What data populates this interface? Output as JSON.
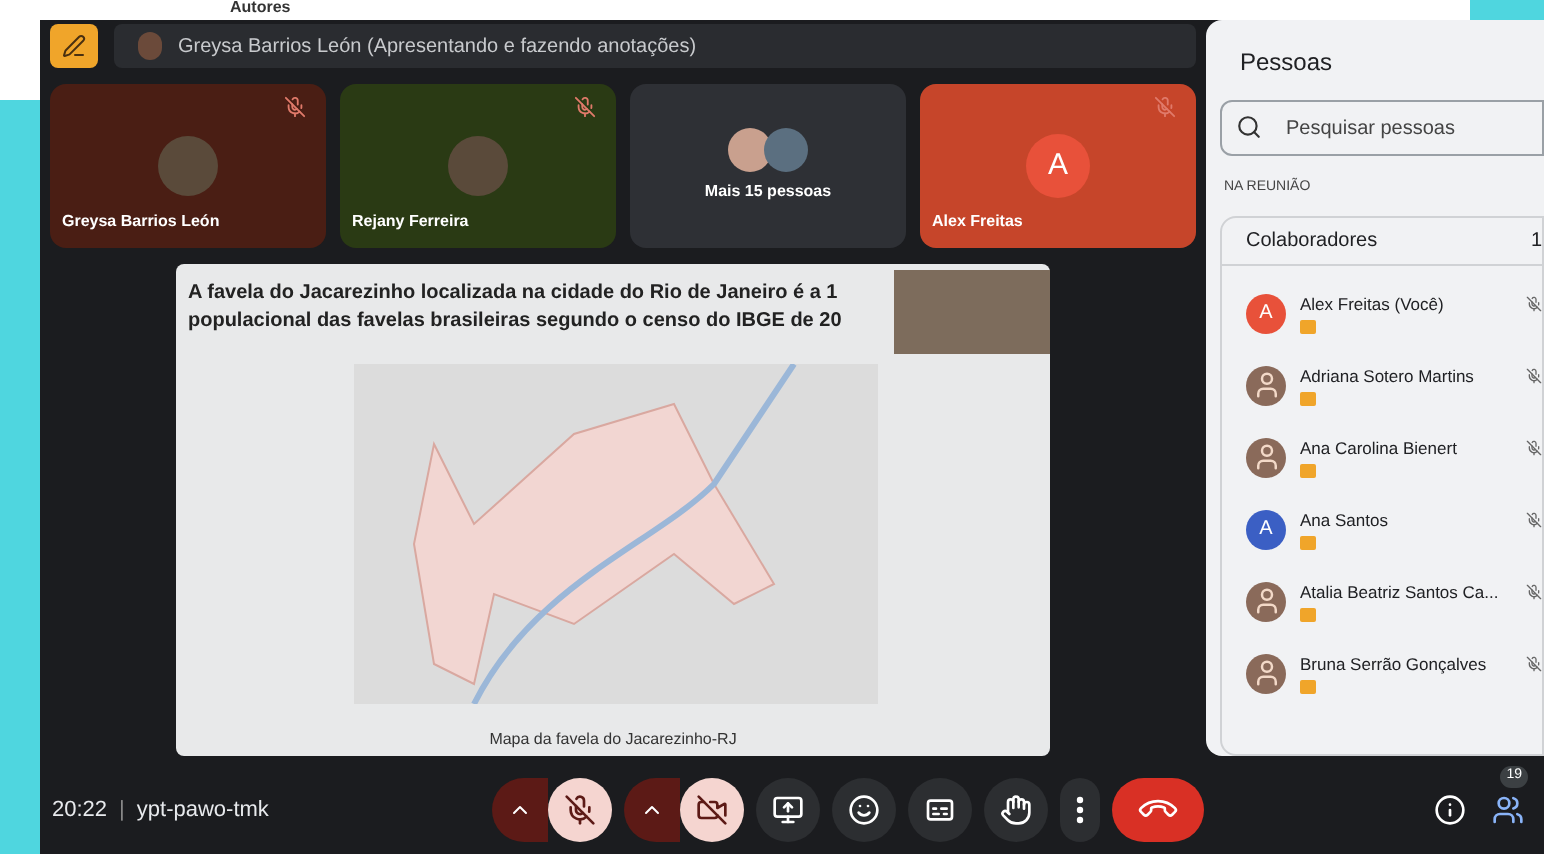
{
  "header": {
    "label": "Autores"
  },
  "presenter_banner": {
    "text": "Greysa Barrios León (Apresentando e fazendo anotações)"
  },
  "tiles": [
    {
      "name": "Greysa Barrios León",
      "kind": "photo",
      "muted": true,
      "color": "#4a1e14"
    },
    {
      "name": "Rejany Ferreira",
      "kind": "photo",
      "muted": true,
      "color": "#2a3a14"
    },
    {
      "name": "Mais 15 pessoas",
      "kind": "group",
      "muted": false,
      "color": "#2e3035"
    },
    {
      "name": "Alex Freitas",
      "kind": "letter",
      "initial": "A",
      "muted": true,
      "color": "#c6452a"
    }
  ],
  "slide": {
    "title": "A favela do Jacarezinho localizada na cidade do Rio de Janeiro é a 1\npopulacional das favelas brasileiras segundo o censo do IBGE de 20",
    "caption": "Mapa da favela do Jacarezinho-RJ"
  },
  "people_panel": {
    "title": "Pessoas",
    "search": {
      "placeholder": "Pesquisar pessoas"
    },
    "section": "NA REUNIÃO",
    "group": {
      "label": "Colaboradores",
      "count": "1"
    },
    "people": [
      {
        "name": "Alex Freitas (Você)",
        "kind": "letter",
        "initial": "A",
        "color": "#e8513a"
      },
      {
        "name": "Adriana Sotero Martins",
        "kind": "photo"
      },
      {
        "name": "Ana Carolina Bienert",
        "kind": "photo"
      },
      {
        "name": "Ana Santos",
        "kind": "letter",
        "initial": "A",
        "color": "#3b5fc4"
      },
      {
        "name": "Atalia Beatriz Santos Ca...",
        "kind": "photo"
      },
      {
        "name": "Bruna Serrão Gonçalves",
        "kind": "photo"
      }
    ]
  },
  "bottom_bar": {
    "time": "20:22",
    "separator": "|",
    "meeting_code": "ypt-pawo-tmk",
    "mic_on": false,
    "camera_on": false,
    "people_count": "19"
  }
}
